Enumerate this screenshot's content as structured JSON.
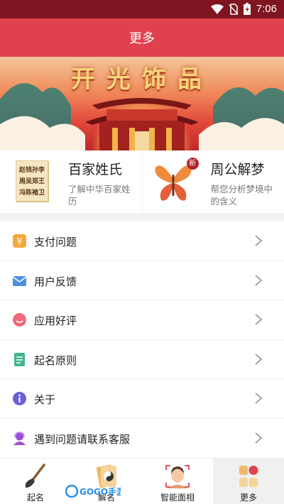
{
  "status_bar": {
    "time": "7:06",
    "icons": [
      "wifi-icon",
      "no-sim-icon",
      "battery-charging-icon"
    ]
  },
  "header": {
    "title": "更多"
  },
  "banner": {
    "title": "开光饰品"
  },
  "feature_cards": [
    {
      "title": "百家姓氏",
      "subtitle": "了解中华百家姓历",
      "icon": "surname-scroll-icon",
      "icon_text": [
        "赵钱孙李",
        "周吴郑王",
        "冯陈褚卫"
      ]
    },
    {
      "title": "周公解梦",
      "subtitle": "帮您分析梦境中的含义",
      "icon": "butterfly-icon",
      "badge": "新"
    }
  ],
  "menu": [
    {
      "label": "支付问题",
      "icon": "payment-icon"
    },
    {
      "label": "用户反馈",
      "icon": "feedback-mail-icon"
    },
    {
      "label": "应用好评",
      "icon": "smile-icon"
    },
    {
      "label": "起名原则",
      "icon": "document-icon"
    },
    {
      "label": "关于",
      "icon": "info-icon"
    },
    {
      "label": "遇到问题请联系客服",
      "icon": "customer-service-icon"
    }
  ],
  "tabs": [
    {
      "label": "起名",
      "icon": "brush-icon",
      "active": false
    },
    {
      "label": "解名",
      "icon": "taiji-cards-icon",
      "active": false
    },
    {
      "label": "智能面相",
      "icon": "face-scan-icon",
      "active": false
    },
    {
      "label": "更多",
      "icon": "more-grid-icon",
      "active": true
    }
  ],
  "colors": {
    "header": "#e1414e",
    "status_bar": "#7e1520",
    "accent": "#e1414e"
  },
  "watermark": "GOGO手游网"
}
